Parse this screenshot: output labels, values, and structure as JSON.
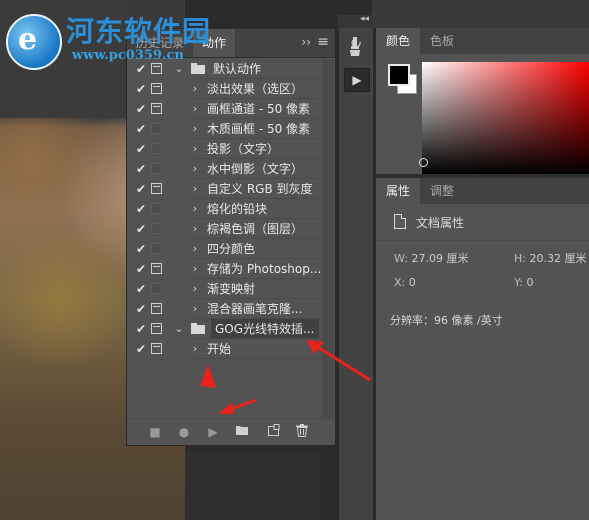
{
  "watermark": {
    "title": "河东软件园",
    "url": "www.pc0359.cn"
  },
  "actions_panel": {
    "tabs": [
      {
        "label": "历史记录",
        "active": false
      },
      {
        "label": "动作",
        "active": true
      }
    ],
    "collapse_icon": "double-chevron-right",
    "menu_icon": "hamburger-menu",
    "items": [
      {
        "kind": "set",
        "checked": true,
        "dialog": true,
        "expanded": true,
        "label": "默认动作"
      },
      {
        "kind": "action",
        "checked": true,
        "dialog": true,
        "label": "淡出效果（选区）"
      },
      {
        "kind": "action",
        "checked": true,
        "dialog": true,
        "label": "画框通道 - 50 像素"
      },
      {
        "kind": "action",
        "checked": true,
        "dialog": false,
        "label": "木质画框 - 50 像素"
      },
      {
        "kind": "action",
        "checked": true,
        "dialog": false,
        "label": "投影（文字）"
      },
      {
        "kind": "action",
        "checked": true,
        "dialog": false,
        "label": "水中倒影（文字）"
      },
      {
        "kind": "action",
        "checked": true,
        "dialog": true,
        "label": "自定义 RGB 到灰度"
      },
      {
        "kind": "action",
        "checked": true,
        "dialog": false,
        "label": "熔化的铅块"
      },
      {
        "kind": "action",
        "checked": true,
        "dialog": false,
        "label": "棕褐色调（图层）"
      },
      {
        "kind": "action",
        "checked": true,
        "dialog": false,
        "label": "四分颜色"
      },
      {
        "kind": "action",
        "checked": true,
        "dialog": true,
        "label": "存储为 Photoshop..."
      },
      {
        "kind": "action",
        "checked": true,
        "dialog": false,
        "label": "渐变映射"
      },
      {
        "kind": "action",
        "checked": true,
        "dialog": true,
        "label": "混合器画笔克隆..."
      },
      {
        "kind": "set",
        "checked": true,
        "dialog": true,
        "expanded": true,
        "label": "GOG光线特效插..."
      },
      {
        "kind": "action",
        "checked": true,
        "dialog": true,
        "label": "开始"
      }
    ],
    "footer_buttons": [
      {
        "name": "stop-button",
        "glyph": "■"
      },
      {
        "name": "record-button",
        "glyph": "●"
      },
      {
        "name": "play-button",
        "glyph": "▶"
      },
      {
        "name": "new-set-button",
        "glyph": "folder"
      },
      {
        "name": "new-action-button",
        "glyph": "new"
      },
      {
        "name": "delete-button",
        "glyph": "trash"
      }
    ]
  },
  "tools_strip": {
    "collapse_icon": "double-chevron-left",
    "history_icon": "history-brush",
    "actions_icon": "play"
  },
  "color_panel": {
    "tabs": [
      {
        "label": "颜色",
        "active": true
      },
      {
        "label": "色板",
        "active": false
      }
    ],
    "foreground": "#000000",
    "background": "#ffffff",
    "hue": "#ff0000"
  },
  "properties_panel": {
    "tabs": [
      {
        "label": "属性",
        "active": true
      },
      {
        "label": "调整",
        "active": false
      }
    ],
    "doc_title": "文档属性",
    "width_label": "W:",
    "width_value": "27.09",
    "width_unit": "厘米",
    "height_label": "H:",
    "height_value": "20.32",
    "height_unit": "厘米",
    "x_label": "X:",
    "x_value": "0",
    "y_label": "Y:",
    "y_value": "0",
    "resolution_label": "分辨率：",
    "resolution_value": "96 像素 /英寸"
  },
  "annotation_color": "#e8231b"
}
